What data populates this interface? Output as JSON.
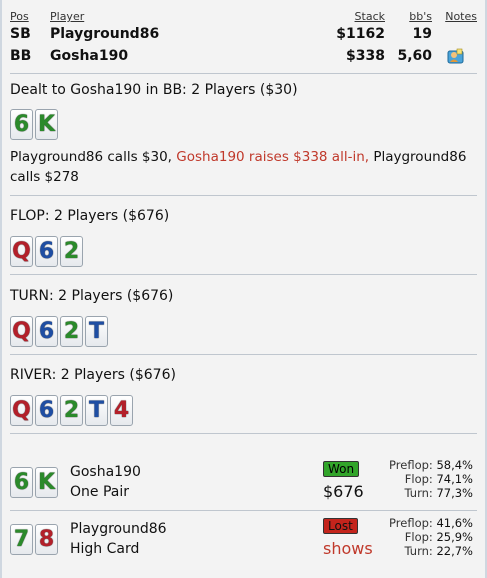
{
  "header": {
    "col_pos": "Pos",
    "col_player": "Player",
    "col_stack": "Stack",
    "col_bbs": "bb's",
    "col_notes": "Notes",
    "rows": [
      {
        "pos": "SB",
        "player": "Playground86",
        "stack": "$1162",
        "bbs": "19"
      },
      {
        "pos": "BB",
        "player": "Gosha190",
        "stack": "$338",
        "bbs": "5,60"
      }
    ]
  },
  "preflop": {
    "title": "Dealt to Gosha190 in BB: 2 Players ($30)",
    "hole_cards": [
      "6",
      "K"
    ],
    "action_a": "Playground86 calls $30, ",
    "action_raise": "Gosha190 raises $338 all-in, ",
    "action_b": "Playground86",
    "action_c": "calls $278"
  },
  "flop": {
    "title": "FLOP: 2 Players ($676)",
    "cards": [
      "Q",
      "6",
      "2"
    ]
  },
  "turn": {
    "title": "TURN: 2 Players ($676)",
    "cards": [
      "Q",
      "6",
      "2",
      "T"
    ]
  },
  "river": {
    "title": "RIVER: 2 Players ($676)",
    "cards": [
      "Q",
      "6",
      "2",
      "T",
      "4"
    ]
  },
  "results": [
    {
      "cards": [
        "6",
        "K"
      ],
      "name": "Gosha190",
      "hand": "One Pair",
      "badge": "Won",
      "amount": "$676",
      "preflop_label": "Preflop:",
      "preflop": "58,4%",
      "flop_label": "Flop:",
      "flop": "74,1%",
      "turn_label": "Turn:",
      "turn": "77,3%"
    },
    {
      "cards": [
        "7",
        "8"
      ],
      "name": "Playground86",
      "hand": "High Card",
      "badge": "Lost",
      "amount": "shows",
      "preflop_label": "Preflop:",
      "preflop": "41,6%",
      "flop_label": "Flop:",
      "flop": "25,9%",
      "turn_label": "Turn:",
      "turn": "22,7%"
    }
  ],
  "colors": {
    "spades": "#2b8a2b",
    "hearts": "#b3202a",
    "diamonds": "#1f4ea3",
    "won": "#32a52a",
    "lost": "#c4241c",
    "raise_text": "#c0392b"
  }
}
